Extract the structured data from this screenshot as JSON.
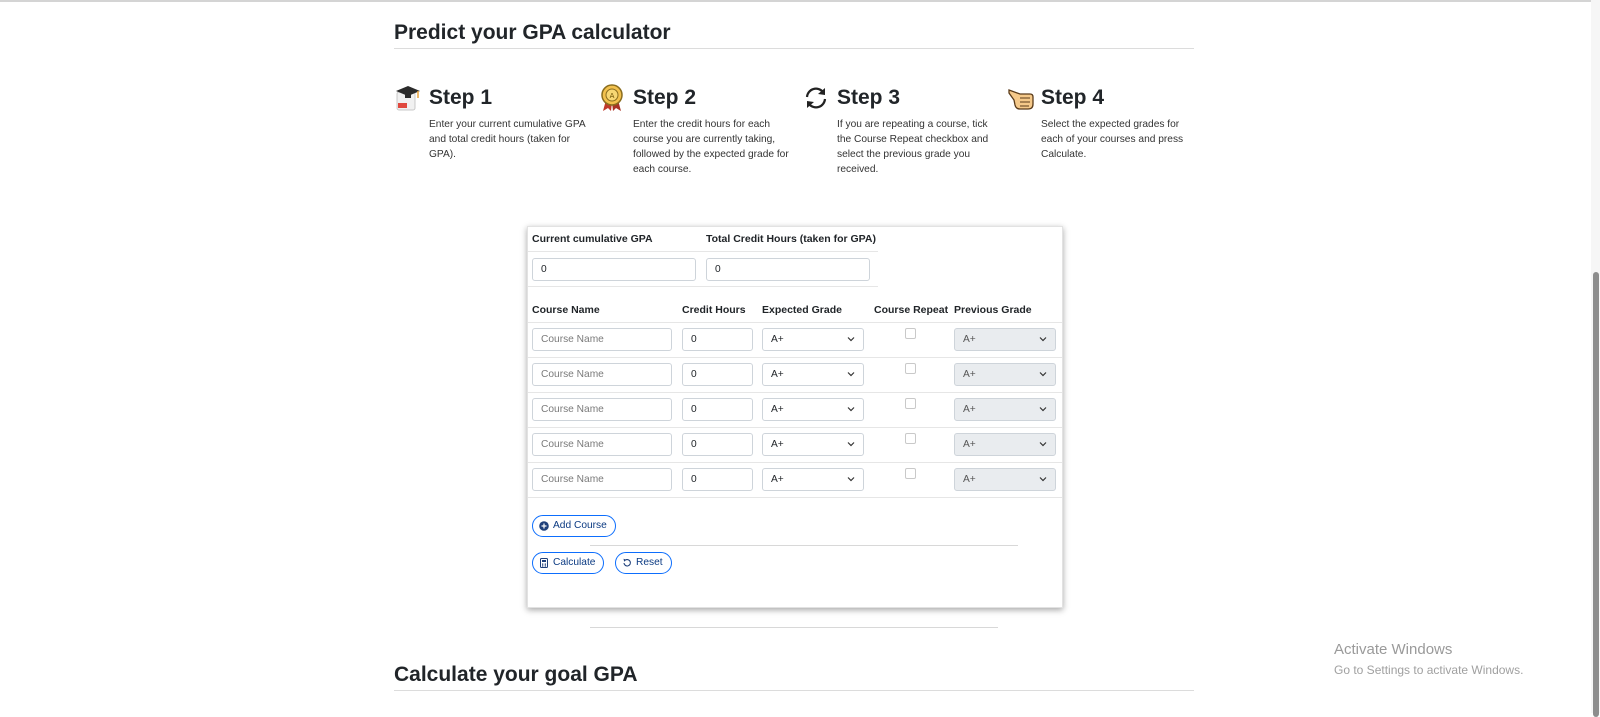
{
  "page": {
    "title": "Predict your GPA calculator",
    "goal_title": "Calculate your goal GPA"
  },
  "steps": [
    {
      "title": "Step 1",
      "description": "Enter your current cumulative GPA and total credit hours (taken for GPA).",
      "icon": "graduation-cap-icon"
    },
    {
      "title": "Step 2",
      "description": "Enter the credit hours for each course you are currently taking, followed by the expected grade for each course.",
      "icon": "award-medal-icon"
    },
    {
      "title": "Step 3",
      "description": "If you are repeating a course, tick the Course Repeat checkbox and select the previous grade you received.",
      "icon": "refresh-icon"
    },
    {
      "title": "Step 4",
      "description": "Select the expected grades for each of your courses and press Calculate.",
      "icon": "pointing-hand-icon"
    }
  ],
  "calculator": {
    "gpa_label": "Current cumulative GPA",
    "gpa_value": "0",
    "credits_label": "Total Credit Hours (taken for GPA)",
    "credits_value": "0",
    "columns": [
      "Course Name",
      "Credit Hours",
      "Expected Grade",
      "Course Repeat",
      "Previous Grade"
    ],
    "course_placeholder": "Course Name",
    "courses": [
      {
        "credit_hours": "0",
        "expected_grade": "A+",
        "repeat": false,
        "previous_grade": "A+"
      },
      {
        "credit_hours": "0",
        "expected_grade": "A+",
        "repeat": false,
        "previous_grade": "A+"
      },
      {
        "credit_hours": "0",
        "expected_grade": "A+",
        "repeat": false,
        "previous_grade": "A+"
      },
      {
        "credit_hours": "0",
        "expected_grade": "A+",
        "repeat": false,
        "previous_grade": "A+"
      },
      {
        "credit_hours": "0",
        "expected_grade": "A+",
        "repeat": false,
        "previous_grade": "A+"
      }
    ],
    "add_course_label": "Add Course",
    "calculate_label": "Calculate",
    "reset_label": "Reset"
  },
  "watermark": {
    "line1": "Activate Windows",
    "line2": "Go to Settings to activate Windows."
  },
  "colors": {
    "accent": "#0d6efd",
    "button_text": "#0b3a82"
  }
}
